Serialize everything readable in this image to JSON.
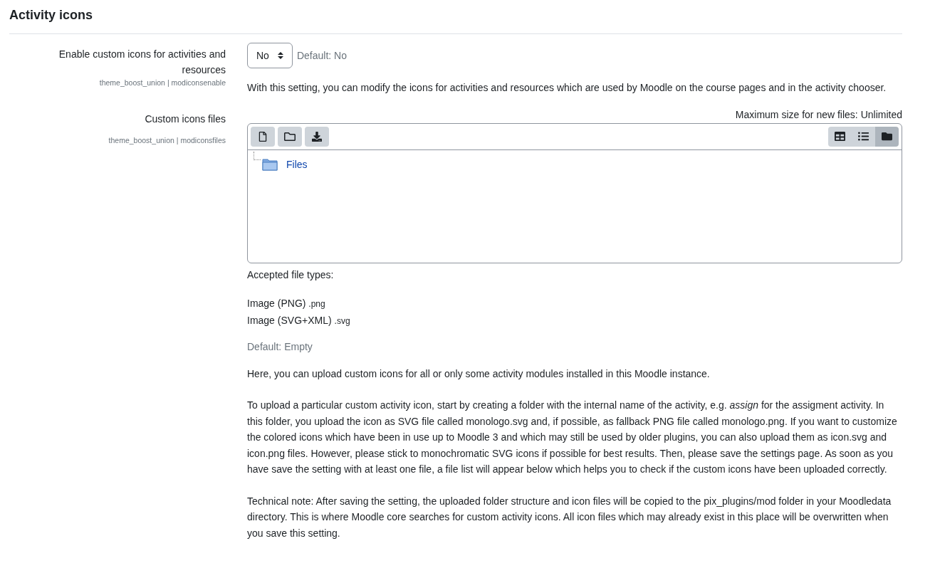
{
  "heading": "Activity icons",
  "settings": [
    {
      "kind": "select",
      "label": "Enable custom icons for activities and resources",
      "meta": "theme_boost_union | modiconsenable",
      "value": "No",
      "default": "Default: No",
      "description": [
        "With this setting, you can modify the icons for activities and resources which are used by Moodle on the course pages and in the activity chooser."
      ]
    },
    {
      "kind": "filemanager",
      "label": "Custom icons files",
      "meta": "theme_boost_union | modiconsfiles",
      "max_size": "Maximum size for new files: Unlimited",
      "views": [
        {
          "kind": "grid",
          "selected": false
        },
        {
          "kind": "list",
          "selected": false
        },
        {
          "kind": "tree",
          "selected": true
        }
      ],
      "root_folder": "Files",
      "accepted_title": "Accepted file types:",
      "file_types": [
        {
          "name": "Image (PNG)",
          "ext": ".png"
        },
        {
          "name": "Image (SVG+XML)",
          "ext": ".svg"
        }
      ],
      "default": "Default: Empty",
      "description": [
        "Here, you can upload custom icons for all or only some activity modules installed in this Moodle instance.",
        "To upload a particular custom activity icon, start by creating a folder with the internal name of the activity, e.g. *assign* for the assigment activity. In this folder, you upload the icon as SVG file called monologo.svg and, if possible, as fallback PNG file called monologo.png. If you want to customize the colored icons which have been in use up to Moodle 3 and which may still be used by older plugins, you can also upload them as icon.svg and icon.png files. However, please stick to monochromatic SVG icons if possible for best results. Then, please save the settings page. As soon as you have save the setting with at least one file, a file list will appear below which helps you to check if the custom icons have been uploaded correctly.",
        "Technical note: After saving the setting, the uploaded folder structure and icon files will be copied to the pix_plugins/mod folder in your Moodledata directory. This is where Moodle core searches for custom activity icons. All icon files which may already exist in this place will be overwritten when you save this setting."
      ]
    }
  ]
}
